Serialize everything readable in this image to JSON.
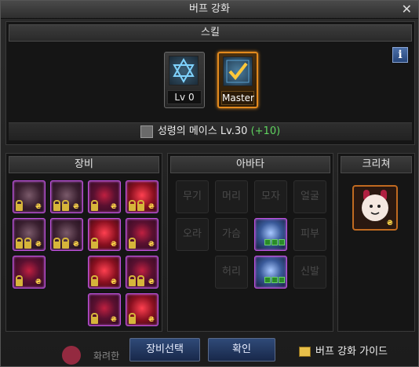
{
  "window": {
    "title": "버프 강화",
    "close_glyph": "✕"
  },
  "skill": {
    "header": "스킬",
    "info_glyph": "i",
    "cards": [
      {
        "label": "Lv 0",
        "icon": "hexagram-icon"
      },
      {
        "label": "Master",
        "icon": "skill-check-icon"
      }
    ],
    "skill_name": "성령의 메이스 Lv.30",
    "skill_bonus": "(+10)"
  },
  "equipment": {
    "header": "장비"
  },
  "avatar": {
    "header": "아바타",
    "slots": [
      "무기",
      "머리",
      "모자",
      "얼굴",
      "오라",
      "가슴",
      "피부",
      "허리",
      "신발"
    ]
  },
  "creature": {
    "header": "크리쳐"
  },
  "footer": {
    "select_button": "장비선택",
    "confirm_button": "확인",
    "guide_label": "버프 강화 가이드",
    "bg_text": "화려한"
  },
  "colors": {
    "accent": "#e38a1e",
    "lock": "#d6b53a",
    "bonus": "#5fd35f",
    "button": "#2f4a78"
  }
}
